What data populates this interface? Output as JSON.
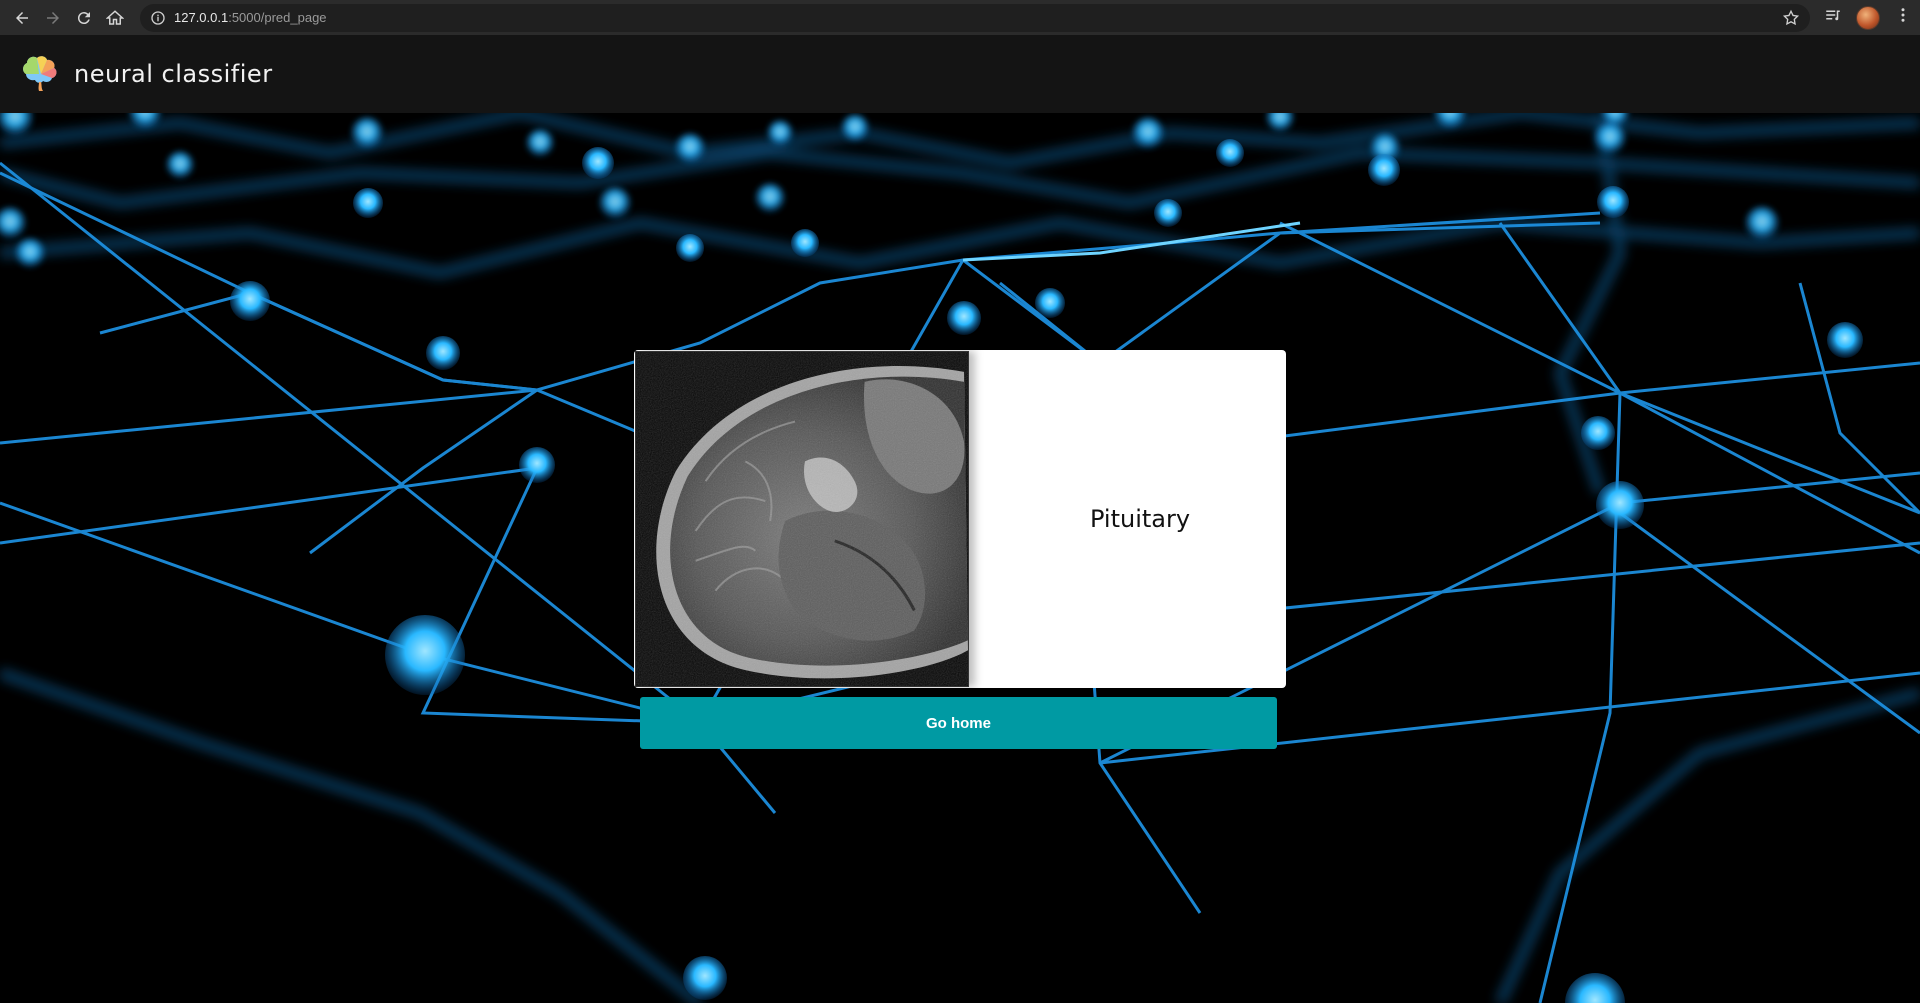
{
  "browser": {
    "url_host": "127.0.0.1",
    "url_path": ":5000/pred_page"
  },
  "app": {
    "brand_name": "neural classifier"
  },
  "result": {
    "prediction": "Pituitary"
  },
  "actions": {
    "home_label": "Go home"
  },
  "colors": {
    "button": "#009aa3",
    "nav_background": "#141414",
    "network_blue": "#1ea0ff"
  }
}
